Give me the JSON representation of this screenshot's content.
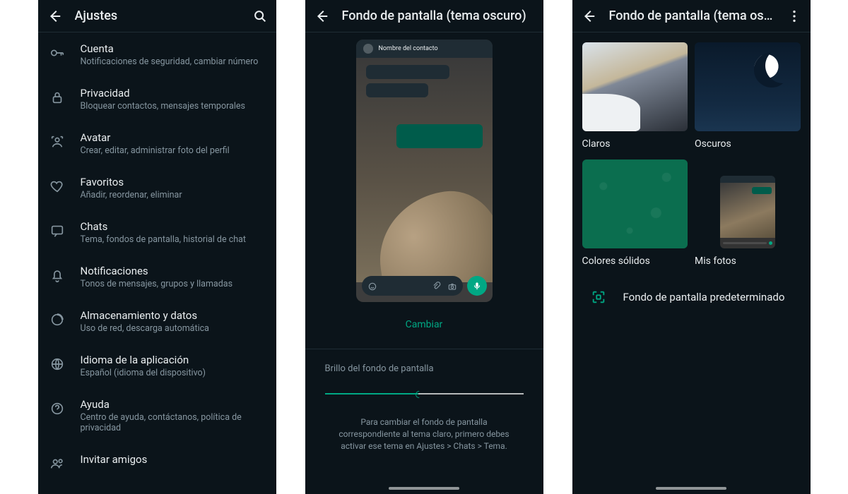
{
  "screen1": {
    "title": "Ajustes",
    "items": [
      {
        "title": "Cuenta",
        "subtitle": "Notificaciones de seguridad, cambiar número"
      },
      {
        "title": "Privacidad",
        "subtitle": "Bloquear contactos, mensajes temporales"
      },
      {
        "title": "Avatar",
        "subtitle": "Crear, editar, administrar foto del perfil"
      },
      {
        "title": "Favoritos",
        "subtitle": "Añadir, reordenar, eliminar"
      },
      {
        "title": "Chats",
        "subtitle": "Tema, fondos de pantalla, historial de chat"
      },
      {
        "title": "Notificaciones",
        "subtitle": "Tonos de mensajes, grupos y llamadas"
      },
      {
        "title": "Almacenamiento y datos",
        "subtitle": "Uso de red, descarga automática"
      },
      {
        "title": "Idioma de la aplicación",
        "subtitle": "Español (idioma del dispositivo)"
      },
      {
        "title": "Ayuda",
        "subtitle": "Centro de ayuda, contáctanos, política de privacidad"
      },
      {
        "title": "Invitar amigos",
        "subtitle": ""
      }
    ]
  },
  "screen2": {
    "title": "Fondo de pantalla (tema oscuro)",
    "contact_name": "Nombre del contacto",
    "change_label": "Cambiar",
    "brightness_label": "Brillo del fondo de pantalla",
    "brightness_percent": 47,
    "hint": "Para cambiar el fondo de pantalla correspondiente al tema claro, primero debes activar ese tema en Ajustes > Chats > Tema."
  },
  "screen3": {
    "title": "Fondo de pantalla (tema osc…",
    "tiles": [
      {
        "label": "Claros"
      },
      {
        "label": "Oscuros"
      },
      {
        "label": "Colores sólidos"
      },
      {
        "label": "Mis fotos"
      }
    ],
    "default_label": "Fondo de pantalla predeterminado"
  }
}
